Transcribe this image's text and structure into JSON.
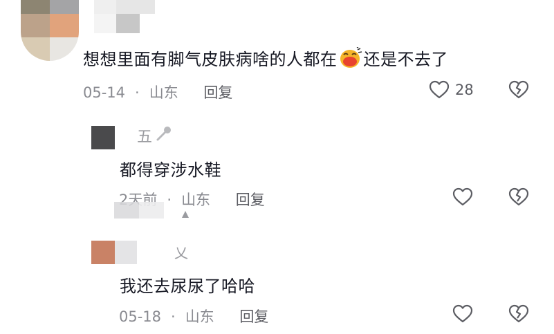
{
  "comments": [
    {
      "text_before_emoji": "想想里面有脚气皮肤病啥的人都在",
      "emoji": "laughing-crying-emoji",
      "text_after_emoji": "还是不去了",
      "date": "05-14",
      "location": "山东",
      "reply_label": "回复",
      "likes": "28"
    },
    {
      "username": "五",
      "text": "都得穿涉水鞋",
      "date": "2天前",
      "location": "山东",
      "reply_label": "回复"
    },
    {
      "username": "乂",
      "text": "我还去尿尿了哈哈",
      "date": "05-18",
      "location": "山东",
      "reply_label": "回复"
    }
  ],
  "separator": "·",
  "colors": {
    "text": "#161823",
    "meta": "#8a8b91",
    "icon": "#5c5d63"
  }
}
